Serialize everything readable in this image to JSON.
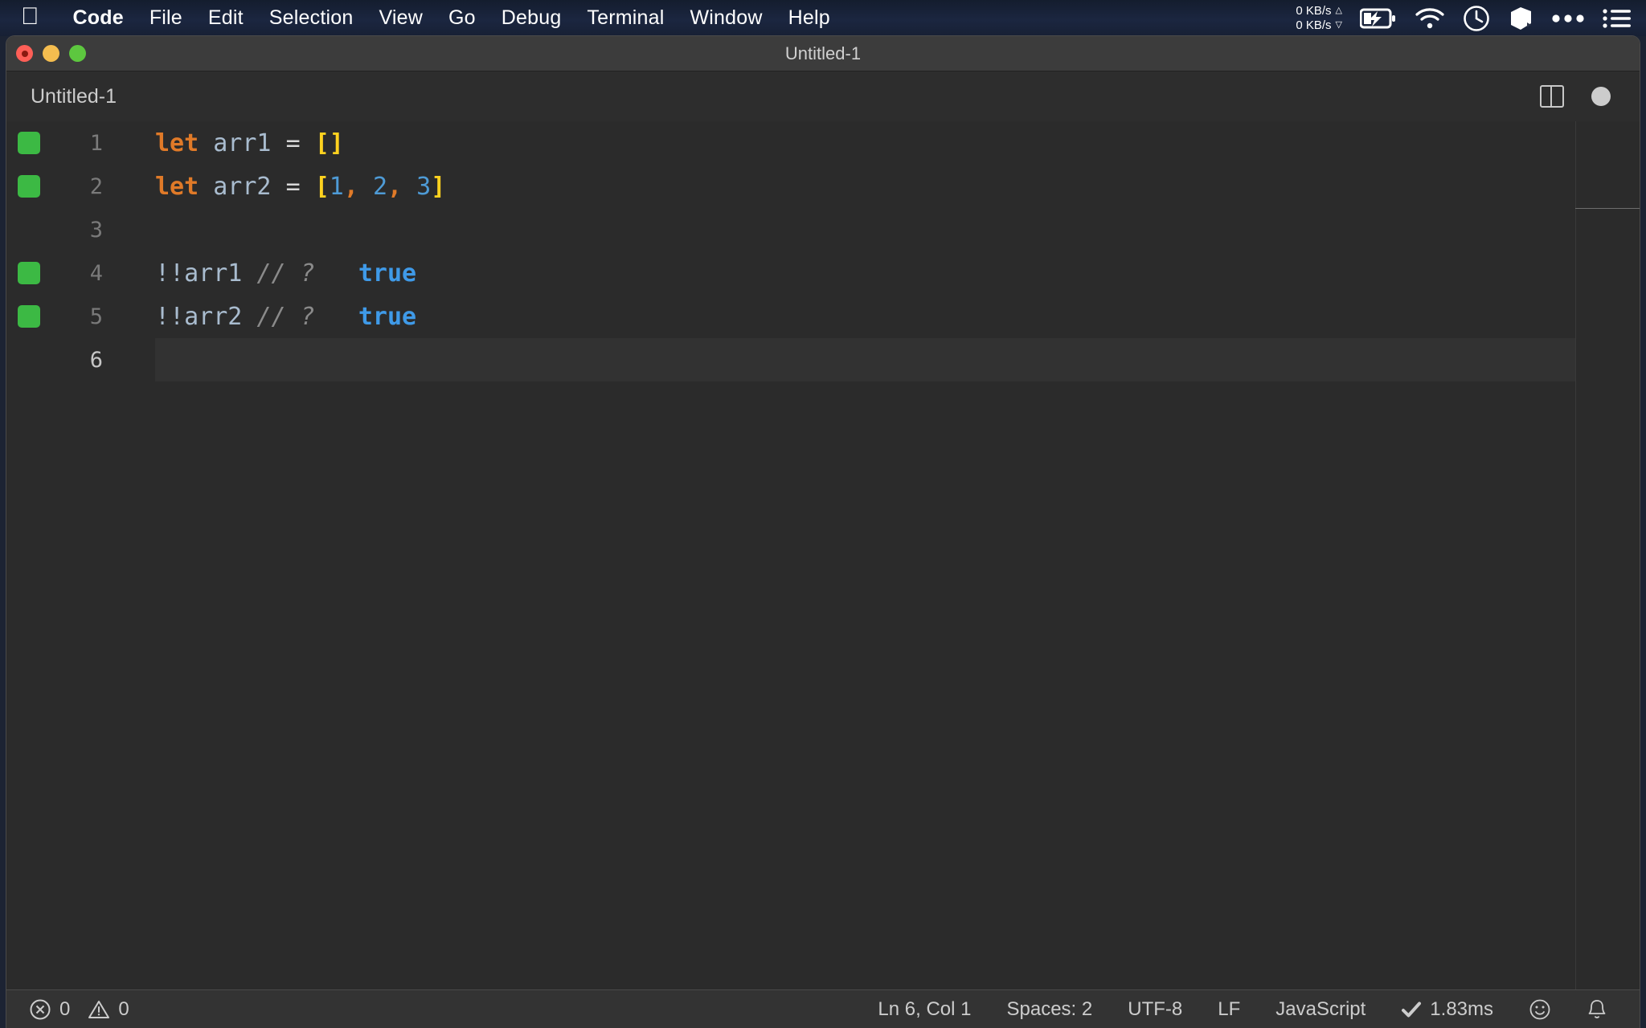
{
  "menubar": {
    "apple_icon": "apple-logo-icon",
    "items": [
      {
        "label": "Code",
        "bold": true
      },
      {
        "label": "File",
        "bold": false
      },
      {
        "label": "Edit",
        "bold": false
      },
      {
        "label": "Selection",
        "bold": false
      },
      {
        "label": "View",
        "bold": false
      },
      {
        "label": "Go",
        "bold": false
      },
      {
        "label": "Debug",
        "bold": false
      },
      {
        "label": "Terminal",
        "bold": false
      },
      {
        "label": "Window",
        "bold": false
      },
      {
        "label": "Help",
        "bold": false
      }
    ],
    "network": {
      "upload": "0 KB/s",
      "download": "0 KB/s",
      "up_arrow": "triangle-up-icon",
      "down_arrow": "triangle-down-icon"
    },
    "status_icons": [
      "battery-charging-icon",
      "wifi-icon",
      "clock-icon",
      "app-icon",
      "ellipsis-icon",
      "control-center-icon"
    ]
  },
  "window": {
    "title": "Untitled-1",
    "traffic_lights": [
      "close-button",
      "minimize-button",
      "maximize-button"
    ]
  },
  "tab": {
    "label": "Untitled-1",
    "split_editor_icon": "split-editor-icon",
    "unsaved_dot": "unsaved-indicator-dot"
  },
  "editor": {
    "language": "JavaScript",
    "lines": [
      {
        "number": "1",
        "marker": true,
        "active": false,
        "tokens": [
          {
            "t": "let",
            "c": "kw"
          },
          {
            "t": " ",
            "c": "op"
          },
          {
            "t": "arr1",
            "c": "id"
          },
          {
            "t": " ",
            "c": "op"
          },
          {
            "t": "=",
            "c": "op"
          },
          {
            "t": " ",
            "c": "op"
          },
          {
            "t": "[]",
            "c": "brk"
          }
        ]
      },
      {
        "number": "2",
        "marker": true,
        "active": false,
        "tokens": [
          {
            "t": "let",
            "c": "kw"
          },
          {
            "t": " ",
            "c": "op"
          },
          {
            "t": "arr2",
            "c": "id"
          },
          {
            "t": " ",
            "c": "op"
          },
          {
            "t": "=",
            "c": "op"
          },
          {
            "t": " ",
            "c": "op"
          },
          {
            "t": "[",
            "c": "brk"
          },
          {
            "t": "1",
            "c": "num"
          },
          {
            "t": ", ",
            "c": "kw"
          },
          {
            "t": "2",
            "c": "num"
          },
          {
            "t": ", ",
            "c": "kw"
          },
          {
            "t": "3",
            "c": "num"
          },
          {
            "t": "]",
            "c": "brk"
          }
        ]
      },
      {
        "number": "3",
        "marker": false,
        "active": false,
        "tokens": []
      },
      {
        "number": "4",
        "marker": true,
        "active": false,
        "tokens": [
          {
            "t": "!!",
            "c": "id"
          },
          {
            "t": "arr1",
            "c": "id"
          },
          {
            "t": " ",
            "c": "op"
          },
          {
            "t": "// ?",
            "c": "com"
          },
          {
            "t": "   ",
            "c": "op"
          },
          {
            "t": "true",
            "c": "res"
          }
        ]
      },
      {
        "number": "5",
        "marker": true,
        "active": false,
        "tokens": [
          {
            "t": "!!",
            "c": "id"
          },
          {
            "t": "arr2",
            "c": "id"
          },
          {
            "t": " ",
            "c": "op"
          },
          {
            "t": "// ?",
            "c": "com"
          },
          {
            "t": "   ",
            "c": "op"
          },
          {
            "t": "true",
            "c": "res"
          }
        ]
      },
      {
        "number": "6",
        "marker": false,
        "active": true,
        "tokens": []
      }
    ]
  },
  "statusbar": {
    "error_icon": "error-circle-icon",
    "error_count": "0",
    "warning_icon": "warning-triangle-icon",
    "warning_count": "0",
    "cursor_position": "Ln 6, Col 1",
    "indentation": "Spaces: 2",
    "encoding": "UTF-8",
    "line_ending": "LF",
    "language_mode": "JavaScript",
    "runtime_check_icon": "checkmark-icon",
    "runtime_duration": "1.83ms",
    "feedback_icon": "smiley-icon",
    "notifications_icon": "bell-icon"
  },
  "colors": {
    "menubar_bg": "#1b2640",
    "titlebar_bg": "#3c3c3c",
    "editor_bg": "#2b2b2b",
    "statusbar_bg": "#333333",
    "keyword": "#e07a28",
    "identifier": "#a9bccf",
    "bracket": "#ffd21f",
    "number": "#4e9bd6",
    "comment": "#8a8a8a",
    "result": "#3f9ae8",
    "gutter_marker_green": "#3cb944"
  }
}
